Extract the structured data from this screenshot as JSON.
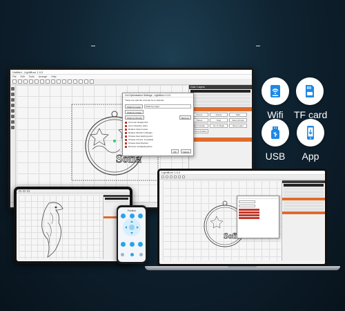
{
  "features": [
    {
      "label": "Wifi",
      "icon": "wifi-icon"
    },
    {
      "label": "TF card",
      "icon": "tf-card-icon"
    },
    {
      "label": "USB",
      "icon": "usb-icon"
    },
    {
      "label": "App",
      "icon": "app-icon"
    }
  ],
  "colors": {
    "accent_blue": "#1e88e5",
    "panel_orange": "#e06b2b",
    "background": "#0f2331"
  },
  "monitor_app": {
    "window_title": "Untitled - LightBurn 1.0.0",
    "menus": [
      "File",
      "Edit",
      "Tools",
      "Arrange",
      "Help"
    ],
    "panel_title": "Cuts / Layers",
    "panel_buttons": [
      "Frame",
      "Frame",
      "Start",
      "Pause",
      "Stop",
      "Save GCode",
      "Run GCode",
      "Go to Origin",
      "Move Laser",
      "Current Position"
    ],
    "dialog": {
      "title": "Cut Optimization Settings - LightBurn 1.0.0",
      "intro": "These are optional, and can be re-ordered.",
      "order_by_layer": "Order by Layer",
      "order_by_group": "Order by Group",
      "order_by_priority": "Order by Priority",
      "field": "Order by Layer",
      "remove_btn": "Remove",
      "options": [
        "Cut inner shapes first",
        "Cut in direction order",
        "Reduce travel moves",
        "Reduce direction changes",
        "Choose best starting point",
        "Choose corners, if possible",
        "Choose best direction",
        "Remove overlapping lines"
      ],
      "ok": "OK",
      "cancel": "Cancel"
    },
    "ornament_text": "Sofia"
  },
  "laptop_app": {
    "window_title": "LightBurn 1.0.0",
    "ornament_text": "Sofia"
  },
  "phone_app": {
    "title": "Position"
  }
}
